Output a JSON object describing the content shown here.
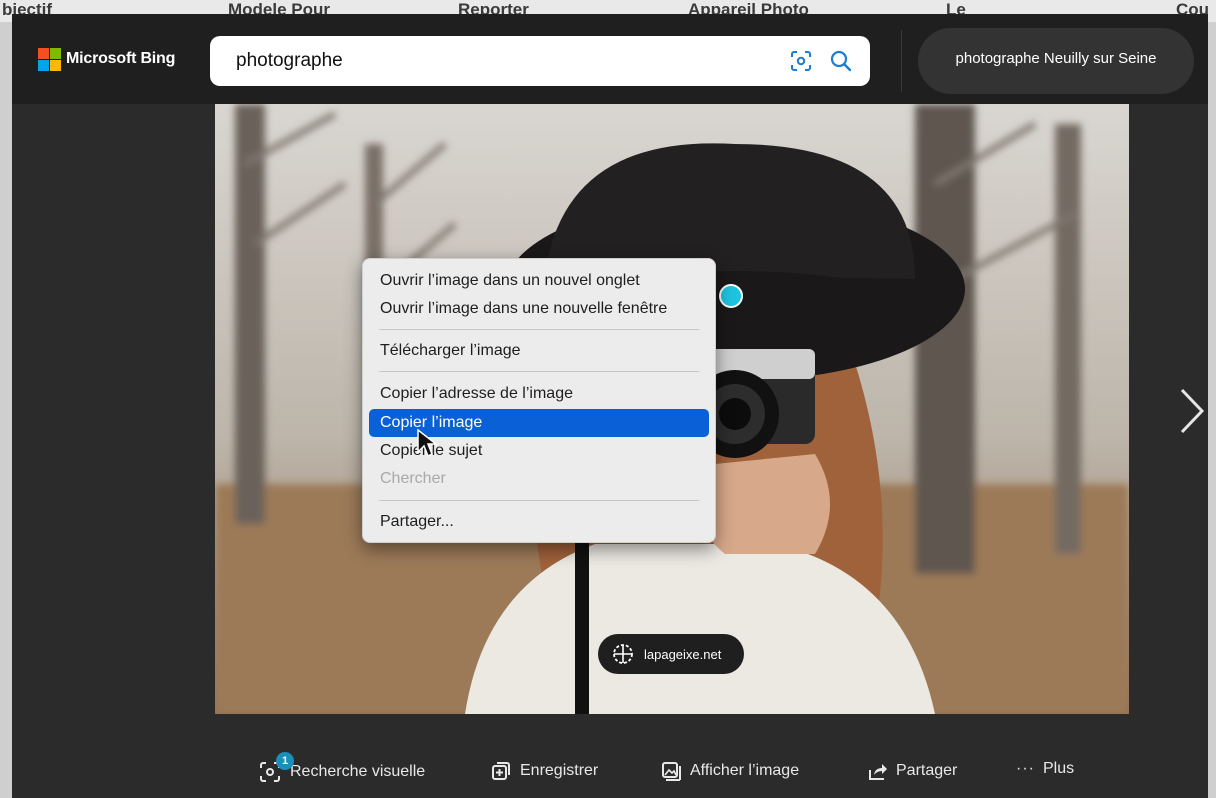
{
  "background_page": {
    "strip_labels": [
      "bjectif",
      "Modele Pour",
      "Reporter",
      "Appareil Photo",
      "Le",
      "Cou"
    ]
  },
  "header": {
    "logo_text": "Microsoft Bing",
    "search_value": "photographe",
    "related_search": "photographe Neuilly sur Seine"
  },
  "viewer": {
    "source_label": "lapageixe.net"
  },
  "context_menu": {
    "items": [
      {
        "label": "Ouvrir l’image dans un nouvel onglet",
        "state": "normal"
      },
      {
        "label": "Ouvrir l’image dans une nouvelle fenêtre",
        "state": "normal"
      },
      {
        "label": "Télécharger l’image",
        "state": "normal"
      },
      {
        "label": "Copier l’adresse de l’image",
        "state": "normal"
      },
      {
        "label": "Copier l’image",
        "state": "selected"
      },
      {
        "label": "Copier le sujet",
        "state": "normal"
      },
      {
        "label": "Chercher",
        "state": "disabled"
      },
      {
        "label": "Partager...",
        "state": "normal"
      }
    ]
  },
  "actions": {
    "visual_search_label": "Recherche visuelle",
    "visual_search_badge": "1",
    "save_label": "Enregistrer",
    "view_image_label": "Afficher l’image",
    "share_label": "Partager",
    "more_label": "Plus"
  },
  "colors": {
    "selection": "#0a60d6",
    "badge": "#1a8fb8",
    "cursor_dot": "#1ec3e0"
  }
}
